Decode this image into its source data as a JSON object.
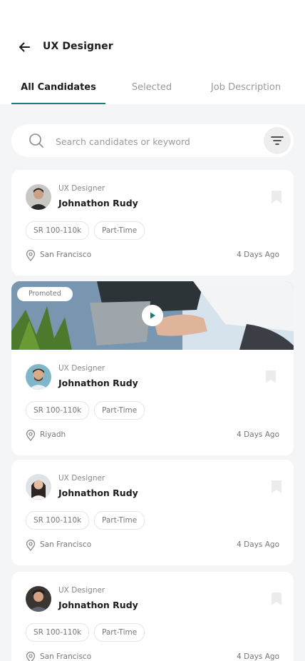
{
  "header": {
    "title": "UX Designer",
    "back_icon": "arrow-left-icon"
  },
  "tabs": [
    {
      "label": "All Candidates",
      "active": true
    },
    {
      "label": "Selected",
      "active": false
    },
    {
      "label": "Job Description",
      "active": false
    }
  ],
  "search": {
    "placeholder": "Search candidates or keyword",
    "value": ""
  },
  "colors": {
    "accent": "#1b7c75",
    "background": "#f4f5f6",
    "card": "#ffffff"
  },
  "candidates": [
    {
      "job_title": "UX Designer",
      "name": "Johnathon Rudy",
      "salary": "SR 100-110k",
      "type": "Part-Time",
      "location": "San Francisco",
      "posted": "4 Days Ago",
      "promoted": false
    },
    {
      "job_title": "UX Designer",
      "name": "Johnathon Rudy",
      "salary": "SR 100-110k",
      "type": "Part-Time",
      "location": "Riyadh",
      "posted": "4 Days Ago",
      "promoted": true,
      "promo_label": "Promoted"
    },
    {
      "job_title": "UX Designer",
      "name": "Johnathon Rudy",
      "salary": "SR 100-110k",
      "type": "Part-Time",
      "location": "San Francisco",
      "posted": "4 Days Ago",
      "promoted": false
    },
    {
      "job_title": "UX Designer",
      "name": "Johnathon Rudy",
      "salary": "SR 100-110k",
      "type": "Part-Time",
      "location": "San Francisco",
      "posted": "4 Days Ago",
      "promoted": false
    }
  ]
}
